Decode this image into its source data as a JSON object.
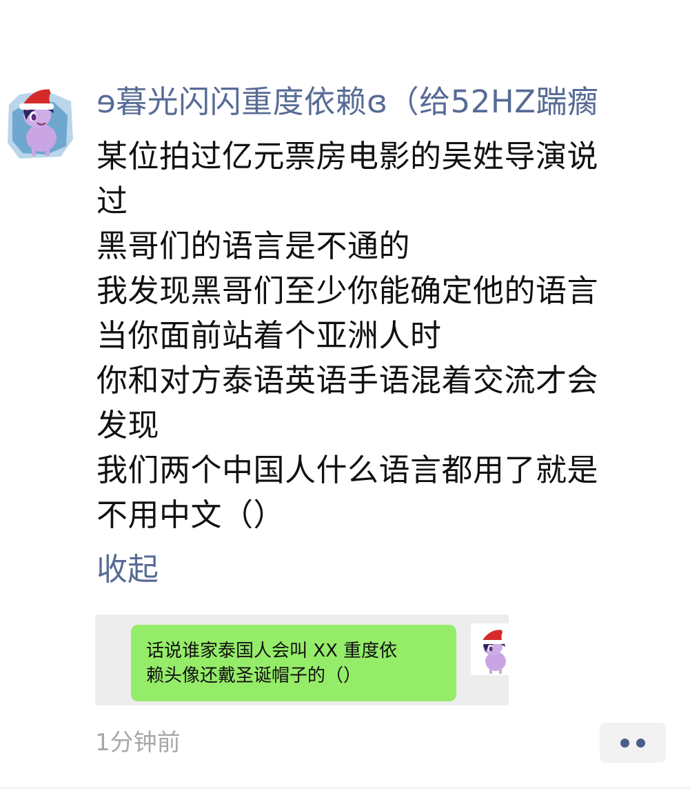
{
  "post": {
    "author": "ɘ暮光闪闪重度依赖ɞ（给52HZ踹瘸",
    "lines": [
      "某位拍过亿元票房电影的吴姓导演说",
      "过",
      "黑哥们的语言是不通的",
      "我发现黑哥们至少你能确定他的语言",
      "当你面前站着个亚洲人时",
      "你和对方泰语英语手语混着交流才会",
      "发现",
      "我们两个中国人什么语言都用了就是",
      "不用中文（）"
    ],
    "collapse_label": "收起",
    "timestamp": "1分钟前"
  },
  "quote": {
    "lines": [
      "话说谁家泰国人会叫 XX 重度依",
      "赖头像还戴圣诞帽子的（）"
    ]
  },
  "icons": {
    "avatar": "pony-avatar-with-santa-hat",
    "quote_avatar": "pony-avatar-with-santa-hat",
    "more": "more-dots-icon"
  },
  "colors": {
    "author": "#576b95",
    "link": "#576b95",
    "bubble": "#95ec69",
    "quote_bg": "#ededed",
    "timestamp": "#a8a8a8",
    "more_dots": "#4a5e8a"
  }
}
